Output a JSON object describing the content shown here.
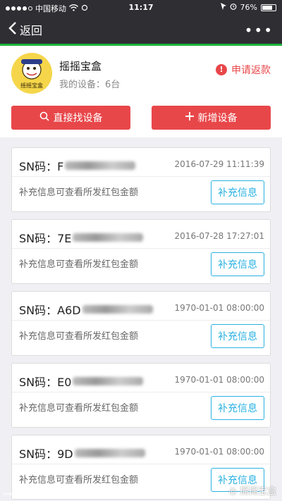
{
  "status_bar": {
    "carrier": "中国移动",
    "time": "11:17",
    "battery": "76%",
    "battery_level": 0.76
  },
  "nav": {
    "back_label": "返回",
    "more_icon": "ellipsis-icon"
  },
  "page_progress": 1.0,
  "header": {
    "logo_text": "摇摇宝盒",
    "shop_name": "摇摇宝盒",
    "device_count": "我的设备：6台",
    "refund_label": "申请返款",
    "find_button": "直接找设备",
    "add_button": "新增设备"
  },
  "devices": [
    {
      "sn_label": "SN码：F",
      "date": "2016-07-29 11:11:39",
      "hint": "补充信息可查看所发红包金额",
      "action": "补充信息"
    },
    {
      "sn_label": "SN码：7E",
      "date": "2016-07-28 17:27:01",
      "hint": "补充信息可查看所发红包金额",
      "action": "补充信息"
    },
    {
      "sn_label": "SN码：A6D",
      "date": "1970-01-01 08:00:00",
      "hint": "补充信息可查看所发红包金额",
      "action": "补充信息"
    },
    {
      "sn_label": "SN码：E0",
      "date": "1970-01-01 08:00:00",
      "hint": "补充信息可查看所发红包金额",
      "action": "补充信息"
    },
    {
      "sn_label": "SN码：9D",
      "date": "1970-01-01 08:00:00",
      "hint": "补充信息可查看所发红包金额",
      "action": "补充信息"
    }
  ],
  "watermark": "摇摇宝盒",
  "colors": {
    "accent_red": "#e8474a",
    "accent_blue": "#2ab1e2",
    "nav_bg": "#2e2e33",
    "progress_green": "#1ab43a"
  }
}
